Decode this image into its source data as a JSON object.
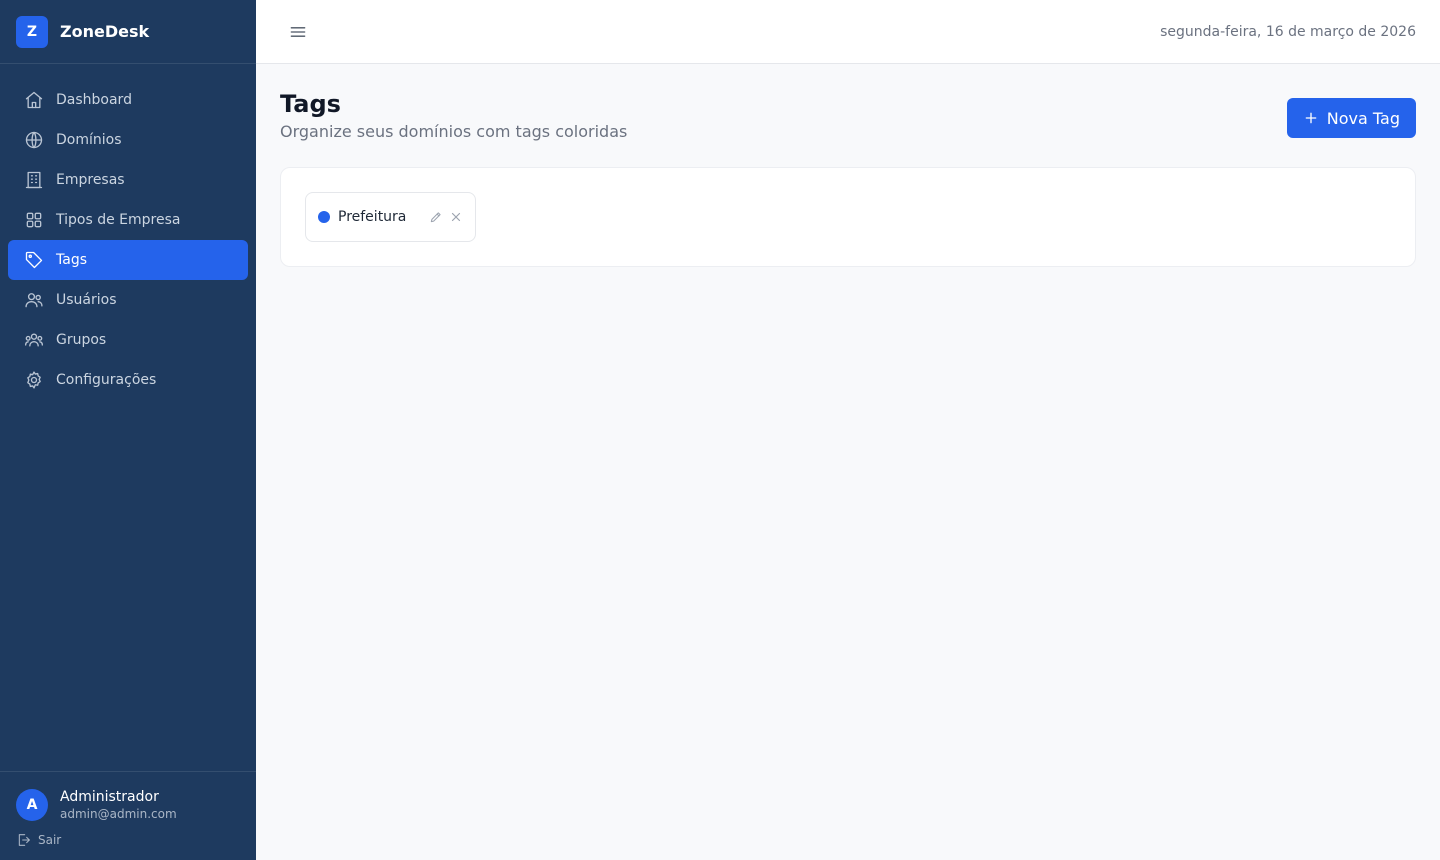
{
  "app": {
    "logo_letter": "Z",
    "name": "ZoneDesk"
  },
  "colors": {
    "sidebar_bg": "#1e3a5f",
    "accent": "#2563eb"
  },
  "sidebar": {
    "items": [
      {
        "label": "Dashboard",
        "icon": "home-icon",
        "active": false
      },
      {
        "label": "Domínios",
        "icon": "globe-icon",
        "active": false
      },
      {
        "label": "Empresas",
        "icon": "building-icon",
        "active": false
      },
      {
        "label": "Tipos de Empresa",
        "icon": "grid-icon",
        "active": false
      },
      {
        "label": "Tags",
        "icon": "tag-icon",
        "active": true
      },
      {
        "label": "Usuários",
        "icon": "users-icon",
        "active": false
      },
      {
        "label": "Grupos",
        "icon": "group-icon",
        "active": false
      },
      {
        "label": "Configurações",
        "icon": "gear-icon",
        "active": false
      }
    ],
    "user": {
      "avatar_letter": "A",
      "name": "Administrador",
      "email": "admin@admin.com"
    },
    "logout_label": "Sair"
  },
  "topbar": {
    "date": "segunda-feira, 16 de março de 2026"
  },
  "page": {
    "title": "Tags",
    "subtitle": "Organize seus domínios com tags coloridas",
    "new_button_label": "Nova Tag"
  },
  "tags": [
    {
      "name": "Prefeitura",
      "color": "#2563eb"
    }
  ]
}
